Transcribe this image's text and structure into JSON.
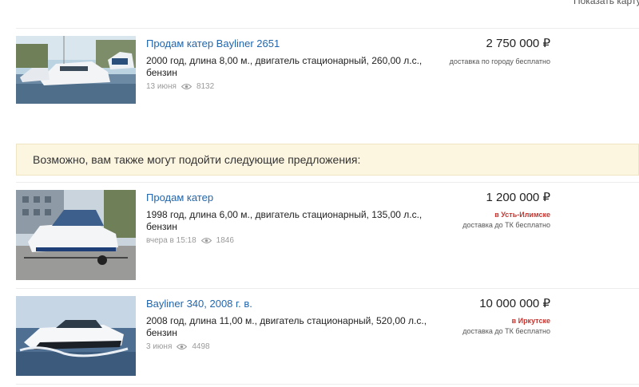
{
  "header": {
    "show_map": "Показать карту"
  },
  "suggestions_banner": "Возможно, вам также могут подойти следующие предложения:",
  "listings": [
    {
      "title": "Продам катер Bayliner 2651",
      "description": "2000 год, длина 8,00 м., двигатель стационарный, 260,00 л.с., бензин",
      "date": "13 июня",
      "views": "8132",
      "price": "2 750 000 ₽",
      "city": "",
      "delivery": "доставка по городу бесплатно",
      "image": "marina-yacht-photo"
    },
    {
      "title": "Продам катер",
      "description": "1998 год, длина 6,00 м., двигатель стационарный, 135,00 л.с., бензин",
      "date": "вчера в 15:18",
      "views": "1846",
      "price": "1 200 000 ₽",
      "city": "в Усть-Илимске",
      "delivery": "доставка до ТК бесплатно",
      "image": "boat-on-trailer-photo"
    },
    {
      "title": "Bayliner 340, 2008 г. в.",
      "description": "2008 год, длина 11,00 м., двигатель стационарный, 520,00 л.с., бензин",
      "date": "3 июня",
      "views": "4498",
      "price": "10 000 000 ₽",
      "city": "в Иркутске",
      "delivery": "доставка до ТК бесплатно",
      "image": "speedboat-on-water-photo"
    }
  ],
  "colors": {
    "title_link": "#2067b0",
    "city": "#c8342e",
    "banner_bg": "#fcf6e1"
  }
}
